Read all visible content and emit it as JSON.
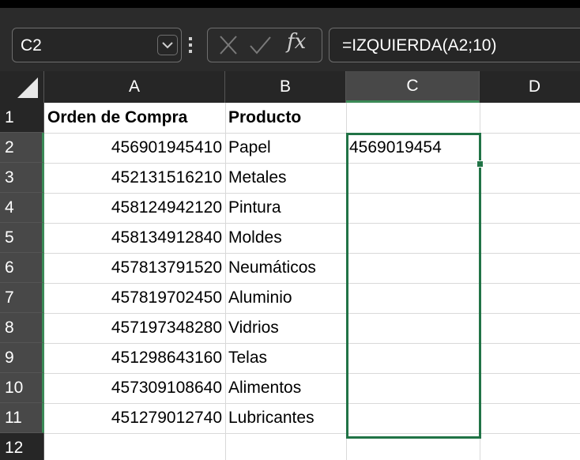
{
  "formula_bar": {
    "name_box": "C2",
    "formula": "=IZQUIERDA(A2;10)",
    "fx_label": "fx"
  },
  "columns": [
    "A",
    "B",
    "C",
    "D"
  ],
  "rows": [
    {
      "num": "1",
      "a": "Orden de Compra",
      "b": "Producto",
      "c": ""
    },
    {
      "num": "2",
      "a": "456901945410",
      "b": "Papel",
      "c": "4569019454"
    },
    {
      "num": "3",
      "a": "452131516210",
      "b": "Metales",
      "c": ""
    },
    {
      "num": "4",
      "a": "458124942120",
      "b": "Pintura",
      "c": ""
    },
    {
      "num": "5",
      "a": "458134912840",
      "b": "Moldes",
      "c": ""
    },
    {
      "num": "6",
      "a": "457813791520",
      "b": "Neumáticos",
      "c": ""
    },
    {
      "num": "7",
      "a": "457819702450",
      "b": "Aluminio",
      "c": ""
    },
    {
      "num": "8",
      "a": "457197348280",
      "b": "Vidrios",
      "c": ""
    },
    {
      "num": "9",
      "a": "451298643160",
      "b": "Telas",
      "c": ""
    },
    {
      "num": "10",
      "a": "457309108640",
      "b": "Alimentos",
      "c": ""
    },
    {
      "num": "11",
      "a": "451279012740",
      "b": "Lubricantes",
      "c": ""
    },
    {
      "num": "12",
      "a": "",
      "b": "",
      "c": ""
    }
  ],
  "selection": {
    "active_cell": "C2",
    "range": "C2:C11"
  },
  "colors": {
    "selection_green": "#217346",
    "header_bg": "#262626",
    "selected_header_bg": "#484848"
  },
  "icons": {
    "name_box_dropdown": "chevron-down-icon",
    "more": "vertical-dots-icon",
    "cancel": "close-icon",
    "enter": "check-icon",
    "function": "fx-icon",
    "select_all": "select-all-triangle-icon"
  }
}
